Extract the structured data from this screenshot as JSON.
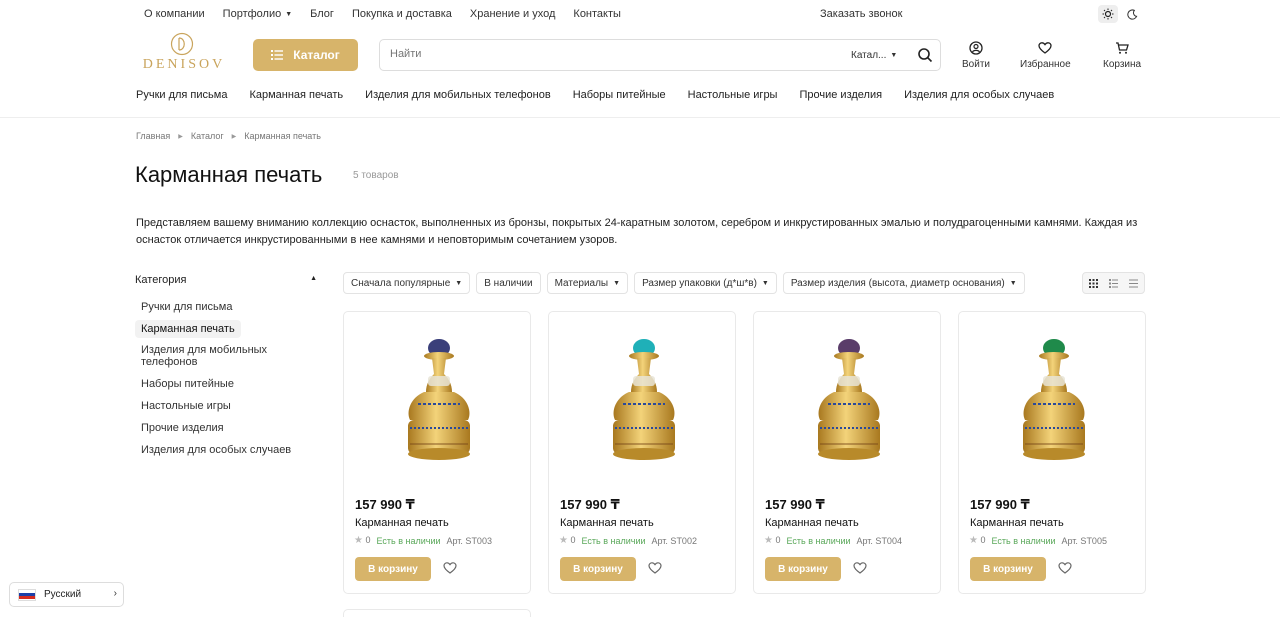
{
  "topnav": {
    "links": [
      "О компании",
      "Портфолио",
      "Блог",
      "Покупка и доставка",
      "Хранение и уход",
      "Контакты"
    ],
    "callback": "Заказать звонок"
  },
  "logo": {
    "text": "DENISOV"
  },
  "catalog_button": "Каталог",
  "search": {
    "placeholder": "Найти",
    "scope": "Катал..."
  },
  "header_actions": {
    "login": "Войти",
    "favorites": "Избранное",
    "cart": "Корзина"
  },
  "catnav": [
    "Ручки для письма",
    "Карманная печать",
    "Изделия для мобильных телефонов",
    "Наборы питейные",
    "Настольные игры",
    "Прочие изделия",
    "Изделия для особых случаев"
  ],
  "breadcrumb": [
    "Главная",
    "Каталог",
    "Карманная печать"
  ],
  "page": {
    "title": "Карманная печать",
    "count": "5 товаров",
    "description": "Представляем вашему вниманию коллекцию оснасток, выполненных из бронзы, покрытых 24-каратным золотом, серебром и инкрустированных эмалью и полудрагоценными камнями. Каждая из оснасток отличается инкрустированными в нее камнями и неповторимым сочетанием узоров."
  },
  "sidebar": {
    "title": "Категория",
    "items": [
      "Ручки для письма",
      "Карманная печать",
      "Изделия для мобильных телефонов",
      "Наборы питейные",
      "Настольные игры",
      "Прочие изделия",
      "Изделия для особых случаев"
    ]
  },
  "filters": [
    "Сначала популярные",
    "В наличии",
    "Материалы",
    "Размер упаковки (д*ш*в)",
    "Размер изделия (высота, диаметр основания)"
  ],
  "products": [
    {
      "price": "157 990 ₸",
      "name": "Карманная печать",
      "rating": "0",
      "stock": "Есть в наличии",
      "sku": "Арт. ST003",
      "gem": "#3a3f7a"
    },
    {
      "price": "157 990 ₸",
      "name": "Карманная печать",
      "rating": "0",
      "stock": "Есть в наличии",
      "sku": "Арт. ST002",
      "gem": "#1fb0b8"
    },
    {
      "price": "157 990 ₸",
      "name": "Карманная печать",
      "rating": "0",
      "stock": "Есть в наличии",
      "sku": "Арт. ST004",
      "gem": "#5a3d6a"
    },
    {
      "price": "157 990 ₸",
      "name": "Карманная печать",
      "rating": "0",
      "stock": "Есть в наличии",
      "sku": "Арт. ST005",
      "gem": "#1f8a4a"
    }
  ],
  "buy_label": "В корзину",
  "language": "Русский",
  "colors": {
    "accent": "#d7b46a",
    "logo": "#c9a45c",
    "in_stock": "#5aa85a"
  }
}
